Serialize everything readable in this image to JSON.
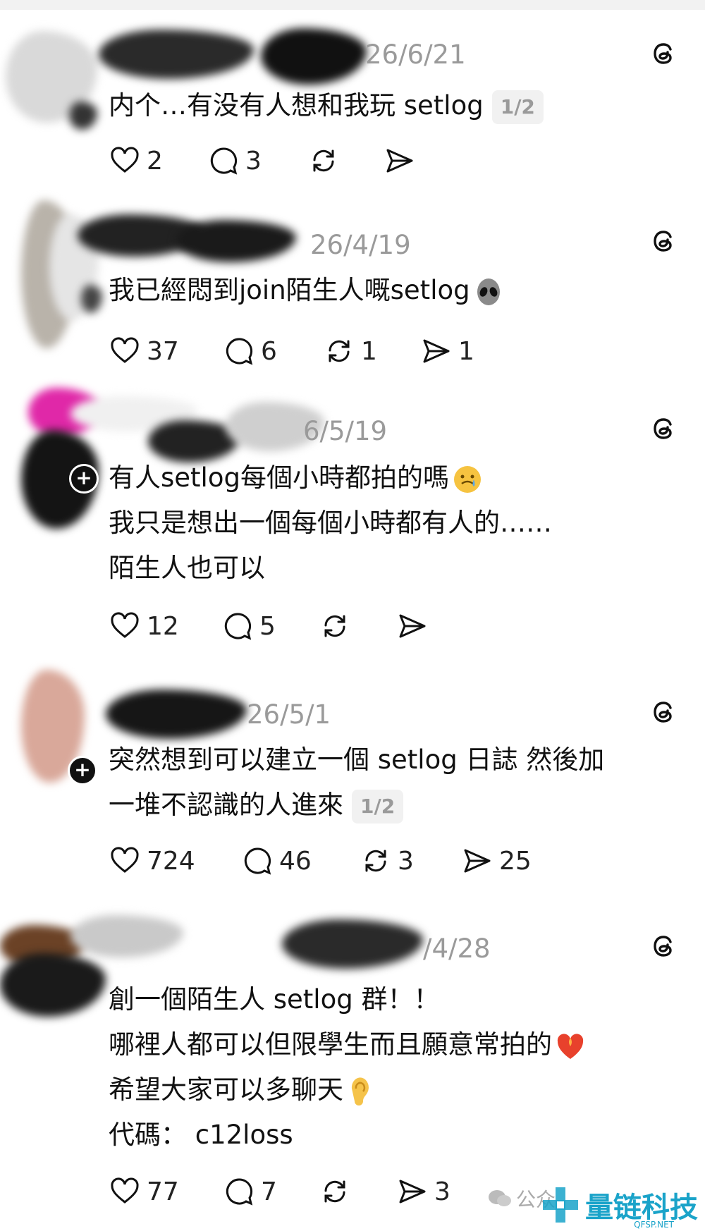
{
  "posts": [
    {
      "date": "26/6/21",
      "lines": [
        "内个…有没有人想和我玩 setlog"
      ],
      "badge": "1/2",
      "likes": "2",
      "replies": "3",
      "reposts": "",
      "shares": ""
    },
    {
      "date": "26/4/19",
      "lines": [
        "我已經悶到join陌生人嘅setlog"
      ],
      "emoji": "alien-emoji",
      "likes": "37",
      "replies": "6",
      "reposts": "1",
      "shares": "1"
    },
    {
      "date": "6/5/19",
      "lines": [
        "有人setlog每個小時都拍的嗎",
        "我只是想出一個每個小時都有人的……",
        "陌生人也可以"
      ],
      "emoji": "crying-face-emoji",
      "likes": "12",
      "replies": "5",
      "reposts": "",
      "shares": ""
    },
    {
      "date": "26/5/1",
      "lines": [
        "突然想到可以建立一個 setlog 日誌 然後加",
        "一堆不認識的人進來"
      ],
      "badge": "1/2",
      "likes": "724",
      "replies": "46",
      "reposts": "3",
      "shares": "25"
    },
    {
      "date": "/4/28",
      "lines": [
        "創一個陌生人 setlog 群！！",
        "哪裡人都可以但限學生而且願意常拍的",
        "希望大家可以多聊天",
        "代碼： c12loss"
      ],
      "likes": "77",
      "replies": "7",
      "reposts": "",
      "shares": "3"
    }
  ],
  "watermark": {
    "brand": "量链科技",
    "sub": "QFSP.NET",
    "public": "公众"
  },
  "colors": {
    "text": "#111111",
    "muted": "#9a9a9a",
    "brand": "#1aa3c9"
  }
}
